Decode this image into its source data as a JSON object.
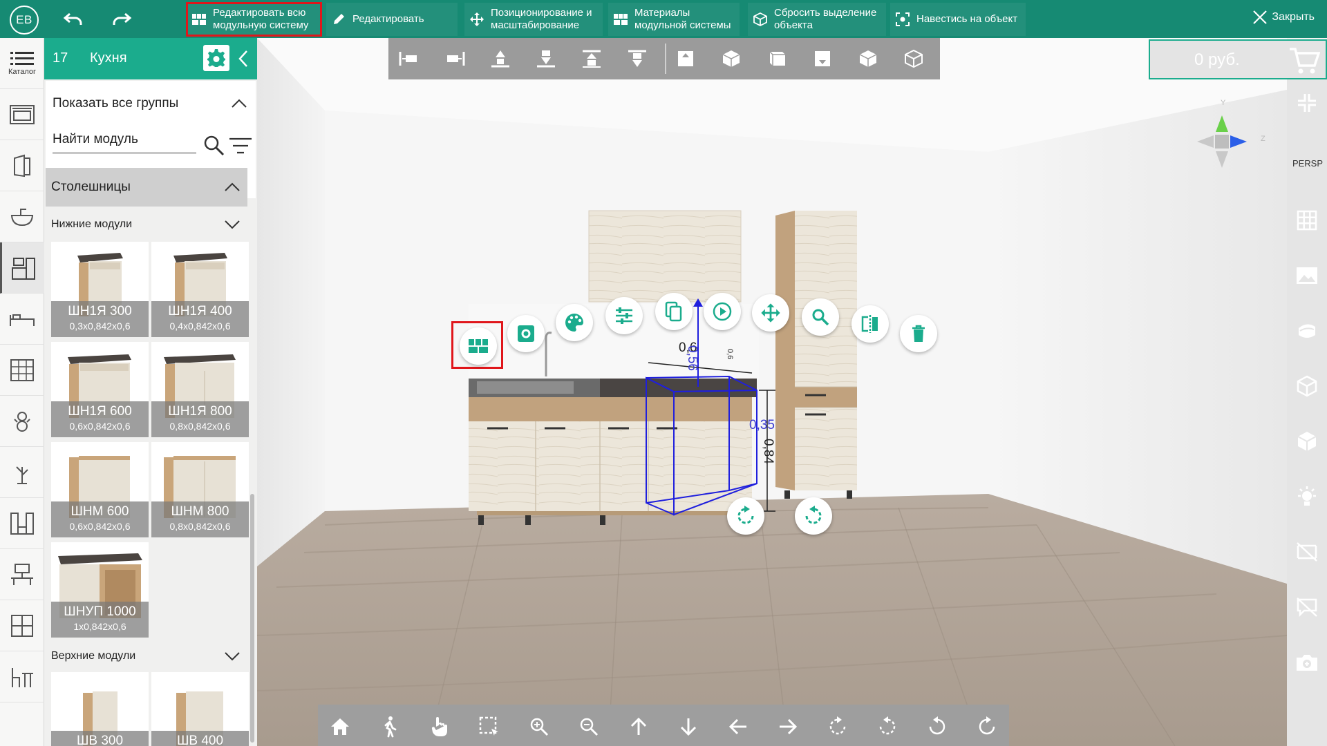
{
  "app": {
    "avatar_initials": "EB",
    "accent": "#168a73",
    "accent_light": "#1bac8d",
    "highlight": "#e0161b"
  },
  "topbar": {
    "undo_icon": "undo-icon",
    "redo_icon": "redo-icon",
    "edit_all_modular": "Редактировать всю\nмодульную систему",
    "edit": "Редактировать",
    "position_scale": "Позиционирование и\nмасштабирование",
    "modular_materials": "Материалы\nмодульной системы",
    "reset_selection": "Сбросить выделение\nобъекта",
    "focus_object": "Навестись на объект",
    "close": "Закрыть"
  },
  "leftrail": {
    "catalog_label": "Каталог"
  },
  "panel": {
    "number": "17",
    "title": "Кухня",
    "show_all_groups": "Показать все группы",
    "search_placeholder": "Найти модуль",
    "sections": {
      "countertops": "Столешницы",
      "lower": "Нижние модули",
      "upper": "Верхние модули"
    },
    "lower_modules": [
      {
        "name": "ШН1Я 300",
        "dims": "0,3x0,842x0,6"
      },
      {
        "name": "ШН1Я 400",
        "dims": "0,4x0,842x0,6"
      },
      {
        "name": "ШН1Я 600",
        "dims": "0,6x0,842x0,6"
      },
      {
        "name": "ШН1Я 800",
        "dims": "0,8x0,842x0,6"
      },
      {
        "name": "ШНМ 600",
        "dims": "0,6x0,842x0,6"
      },
      {
        "name": "ШНМ 800",
        "dims": "0,8x0,842x0,6"
      },
      {
        "name": "ШНУП 1000",
        "dims": "1x0,842x0,6"
      }
    ],
    "upper_modules": [
      {
        "name": "ШВ 300"
      },
      {
        "name": "ШВ 400"
      }
    ]
  },
  "price": {
    "value": "0 руб."
  },
  "rightrail": {
    "persp_label": "PERSP"
  },
  "viewport": {
    "dims": {
      "width": "0,6",
      "height_top": "0,56",
      "height_top_small": "0,6",
      "depth": "0,35",
      "height_side": "0,84"
    },
    "axes": {
      "y": "Y",
      "z": "Z"
    }
  }
}
